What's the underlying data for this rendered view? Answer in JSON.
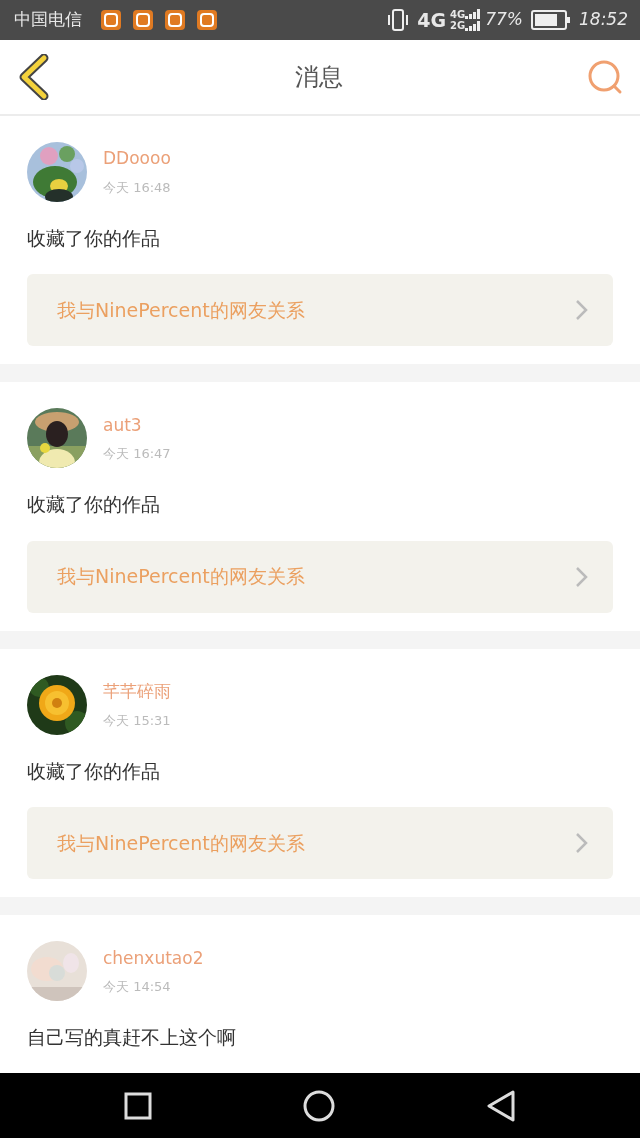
{
  "status_bar": {
    "carrier": "中国电信",
    "network": "4G",
    "sim_1": "4G",
    "sim_2": "2G",
    "battery": "77%",
    "time": "18:52"
  },
  "header": {
    "title": "消息"
  },
  "messages": [
    {
      "user": "DDoooo",
      "time": "今天 16:48",
      "text": "收藏了你的作品",
      "link": "我与NinePercent的网友关系"
    },
    {
      "user": "aut3",
      "time": "今天 16:47",
      "text": "收藏了你的作品",
      "link": "我与NinePercent的网友关系"
    },
    {
      "user": "芊芊碎雨",
      "time": "今天 15:31",
      "text": "收藏了你的作品",
      "link": "我与NinePercent的网友关系"
    },
    {
      "user": "chenxutao2",
      "time": "今天 14:54",
      "text": "自己写的真赶不上这个啊"
    }
  ]
}
